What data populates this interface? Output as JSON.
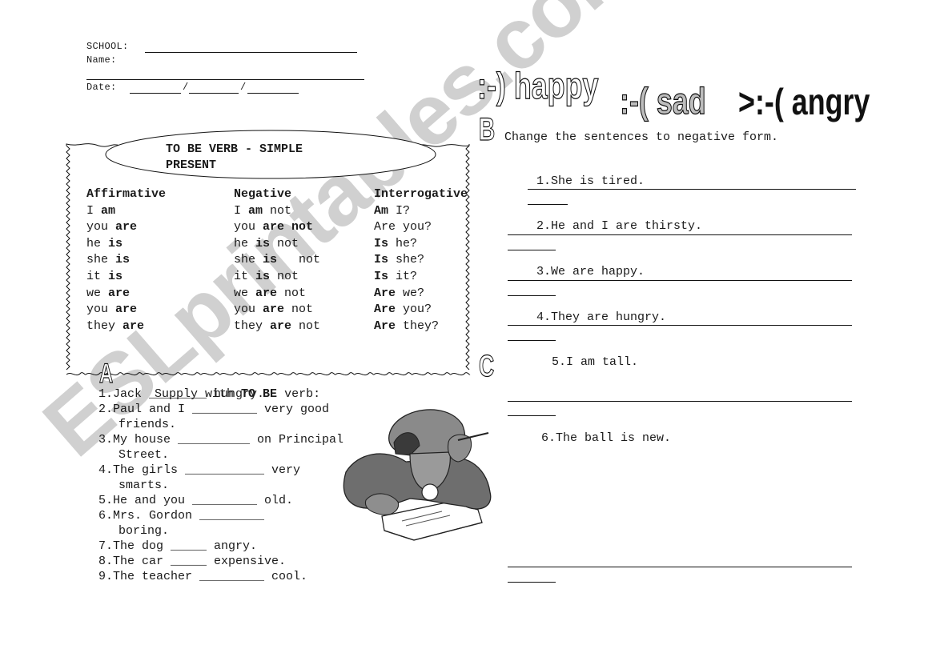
{
  "header": {
    "school_label": "SCHOOL:",
    "name_label": "Name:",
    "date_label": "Date:",
    "date_separator": "/"
  },
  "grammar_box": {
    "title_line1": "TO BE VERB - SIMPLE",
    "title_line2": "PRESENT",
    "columns": [
      {
        "header": "Affirmative",
        "rows": [
          {
            "pre": "I ",
            "bold": "am",
            "post": ""
          },
          {
            "pre": "you ",
            "bold": "are",
            "post": ""
          },
          {
            "pre": "he ",
            "bold": "is",
            "post": ""
          },
          {
            "pre": "she ",
            "bold": "is",
            "post": ""
          },
          {
            "pre": "it ",
            "bold": "is",
            "post": ""
          },
          {
            "pre": "we ",
            "bold": "are",
            "post": ""
          },
          {
            "pre": "you ",
            "bold": "are",
            "post": ""
          },
          {
            "pre": "they ",
            "bold": "are",
            "post": ""
          }
        ]
      },
      {
        "header": "Negative",
        "rows": [
          {
            "pre": "I ",
            "bold": "am",
            "post": " not"
          },
          {
            "pre": "you ",
            "bold": "are not",
            "post": ""
          },
          {
            "pre": "he ",
            "bold": "is",
            "post": " not"
          },
          {
            "pre": "she ",
            "bold": "is",
            "post": "   not"
          },
          {
            "pre": "it ",
            "bold": "is",
            "post": " not"
          },
          {
            "pre": "we ",
            "bold": "are",
            "post": " not"
          },
          {
            "pre": "you ",
            "bold": "are",
            "post": " not"
          },
          {
            "pre": "they ",
            "bold": "are",
            "post": " not"
          }
        ]
      },
      {
        "header": "Interrogative",
        "rows": [
          {
            "pre": "",
            "bold": "Am",
            "post": " I?"
          },
          {
            "pre": "Are you?",
            "bold": "",
            "post": ""
          },
          {
            "pre": "",
            "bold": "Is",
            "post": " he?"
          },
          {
            "pre": "",
            "bold": "Is",
            "post": " she?"
          },
          {
            "pre": "",
            "bold": "Is",
            "post": " it?"
          },
          {
            "pre": "",
            "bold": "Are",
            "post": " we?"
          },
          {
            "pre": "",
            "bold": "Are",
            "post": " you?"
          },
          {
            "pre": "",
            "bold": "Are",
            "post": " they?"
          }
        ]
      }
    ]
  },
  "emoticons": {
    "happy": ":-) happy",
    "sad": ":-( sad",
    "angry": ">:-( angry"
  },
  "section_a": {
    "letter": "A",
    "instruction_pre": "Supply with ",
    "instruction_bold": "TO BE",
    "instruction_post": " verb:",
    "items": [
      {
        "num": "1.",
        "line1": "Jack ________ hungry.",
        "line2": ""
      },
      {
        "num": "2.",
        "line1": "Paul and I _________ very good",
        "line2": "friends."
      },
      {
        "num": "3.",
        "line1": "My house __________ on Principal",
        "line2": "Street."
      },
      {
        "num": "4.",
        "line1": "The girls ___________ very",
        "line2": "smarts."
      },
      {
        "num": "5.",
        "line1": "He and you _________ old.",
        "line2": ""
      },
      {
        "num": "6.",
        "line1": "Mrs. Gordon _________",
        "line2": "boring."
      },
      {
        "num": "7.",
        "line1": "The dog _____ angry.",
        "line2": ""
      },
      {
        "num": "8.",
        "line1": "The car _____ expensive.",
        "line2": ""
      },
      {
        "num": "9.",
        "line1": "The teacher _________ cool.",
        "line2": ""
      }
    ]
  },
  "section_b": {
    "letter": "B",
    "instruction": "Change the sentences to negative form.",
    "items": [
      {
        "num": "1.",
        "text": "She is tired."
      },
      {
        "num": "2.",
        "text": "He and I are thirsty."
      },
      {
        "num": "3.",
        "text": "We are happy."
      },
      {
        "num": "4.",
        "text": "They are hungry."
      },
      {
        "num": "5.",
        "text": "I am tall."
      },
      {
        "num": "6.",
        "text": "The ball is new."
      }
    ]
  },
  "section_c": {
    "letter": "C"
  },
  "illustration": {
    "description": "boy-in-cap-writing-clipart"
  },
  "watermark": {
    "text": "ESLprintables.com",
    "color": "#cccccc"
  }
}
